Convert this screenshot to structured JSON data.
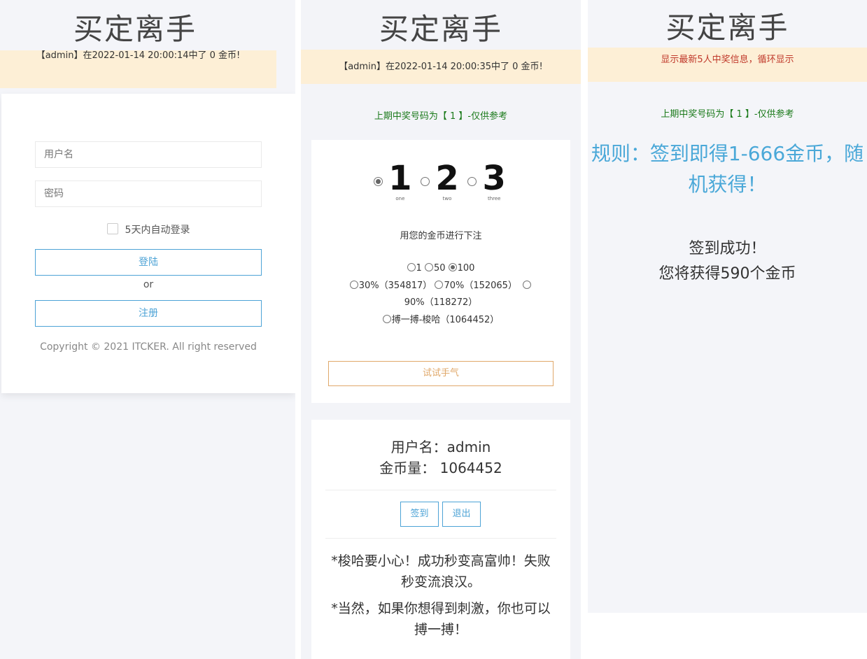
{
  "login_page": {
    "title": "买定离手",
    "notice": "【admin】在2022-01-14 20:00:14中了 0 金币!",
    "username_placeholder": "用户名",
    "password_placeholder": "密码",
    "remember_label": "5天内自动登录",
    "login_button": "登陆",
    "or_text": "or",
    "register_button": "注册",
    "copyright": "Copyright © 2021 ITCKER. All right reserved"
  },
  "game_page": {
    "title": "买定离手",
    "notice": "【admin】在2022-01-14 20:00:35中了 0 金币!",
    "last_draw": "上期中奖号码为【 1 】-仅供参考",
    "digits": [
      {
        "num": "1",
        "label": "one",
        "checked": true
      },
      {
        "num": "2",
        "label": "two",
        "checked": false
      },
      {
        "num": "3",
        "label": "three",
        "checked": false
      }
    ],
    "bet_prompt": "用您的金币进行下注",
    "amounts": [
      {
        "label": "1",
        "checked": false
      },
      {
        "label": "50",
        "checked": false
      },
      {
        "label": "100",
        "checked": true
      }
    ],
    "odds_1": "30%（354817）",
    "odds_2": "70%（152065）",
    "odds_3": "90%（118272）",
    "odds_4": "搏一搏-梭哈（1064452）",
    "try_button": "试试手气",
    "username_line": "用户名：admin",
    "coins_line": "金币量： 1064452",
    "signin_button": "签到",
    "logout_button": "退出",
    "tip_1": "*梭哈要小心！成功秒变高富帅！失败秒变流浪汉。",
    "tip_2": "*当然，如果你想得到刺激，你也可以搏一搏！"
  },
  "signin_page": {
    "title": "买定离手",
    "notice": "显示最新5人中奖信息，循环显示",
    "last_draw": "上期中奖号码为【 1 】-仅供参考",
    "rule": "规则：签到即得1-666金币，随机获得！",
    "success_1": "签到成功！",
    "success_2": "您将获得590个金币"
  },
  "colors": {
    "accent_blue": "#4da3d6",
    "notice_bg": "#fdefd6",
    "green_text": "#1b7a1b",
    "orange_button": "#e0a86a",
    "red_text": "#c0392b"
  }
}
